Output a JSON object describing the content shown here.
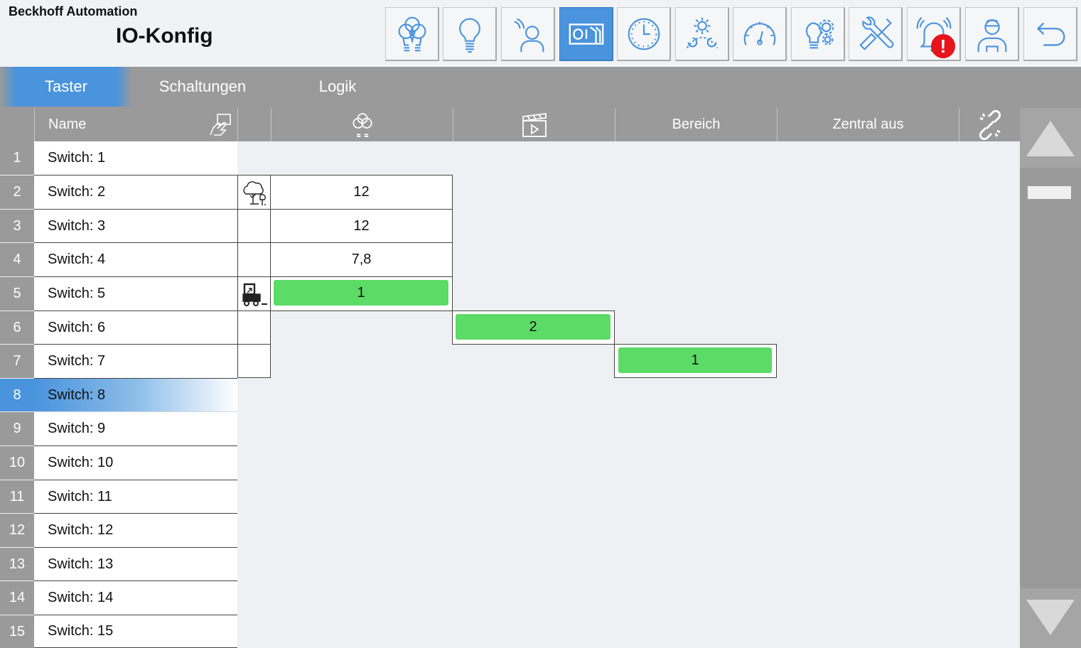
{
  "header": {
    "company": "Beckhoff Automation",
    "title": "IO-Konfig",
    "toolbar": [
      {
        "icon": "bulbs-group-icon",
        "active": false
      },
      {
        "icon": "bulb-icon",
        "active": false
      },
      {
        "icon": "presence-person-icon",
        "active": false
      },
      {
        "icon": "io-config-icon",
        "active": true
      },
      {
        "icon": "clock-icon",
        "active": false
      },
      {
        "icon": "daylight-icon",
        "active": false
      },
      {
        "icon": "gauge-icon",
        "active": false
      },
      {
        "icon": "bulb-gears-icon",
        "active": false
      },
      {
        "icon": "tools-icon",
        "active": false
      },
      {
        "icon": "alarm-bell-icon",
        "active": false,
        "badge": "!"
      },
      {
        "icon": "user-icon",
        "active": false
      },
      {
        "icon": "back-arrow-icon",
        "active": false
      }
    ],
    "accent_color": "#4a93dd",
    "alert_color": "#e8141b"
  },
  "tabs": [
    {
      "label": "Taster",
      "active": true
    },
    {
      "label": "Schaltungen",
      "active": false
    },
    {
      "label": "Logik",
      "active": false
    }
  ],
  "columns": {
    "name": "Name",
    "name_icon": "touch-hand-icon",
    "light_icon": "bulbs-group-icon",
    "scene_icon": "clapperboard-icon",
    "bereich": "Bereich",
    "zentral_aus": "Zentral aus",
    "link_icon": "broken-link-icon"
  },
  "rows": [
    {
      "num": "1",
      "name": "Switch: 1"
    },
    {
      "num": "2",
      "name": "Switch: 2",
      "type_icon": "tree-icon",
      "light": "12"
    },
    {
      "num": "3",
      "name": "Switch: 3",
      "light": "12"
    },
    {
      "num": "4",
      "name": "Switch: 4",
      "light": "7,8"
    },
    {
      "num": "5",
      "name": "Switch: 5",
      "type_icon": "forklift-icon",
      "light": "1"
    },
    {
      "num": "6",
      "name": "Switch: 6",
      "scene": "2"
    },
    {
      "num": "7",
      "name": "Switch: 7",
      "bereich": "1"
    },
    {
      "num": "8",
      "name": "Switch: 8",
      "selected": true
    },
    {
      "num": "9",
      "name": "Switch: 9"
    },
    {
      "num": "10",
      "name": "Switch: 10"
    },
    {
      "num": "11",
      "name": "Switch: 11"
    },
    {
      "num": "12",
      "name": "Switch: 12"
    },
    {
      "num": "13",
      "name": "Switch: 13"
    },
    {
      "num": "14",
      "name": "Switch: 14"
    },
    {
      "num": "15",
      "name": "Switch: 15"
    }
  ],
  "highlight_color": "#5cdb67"
}
